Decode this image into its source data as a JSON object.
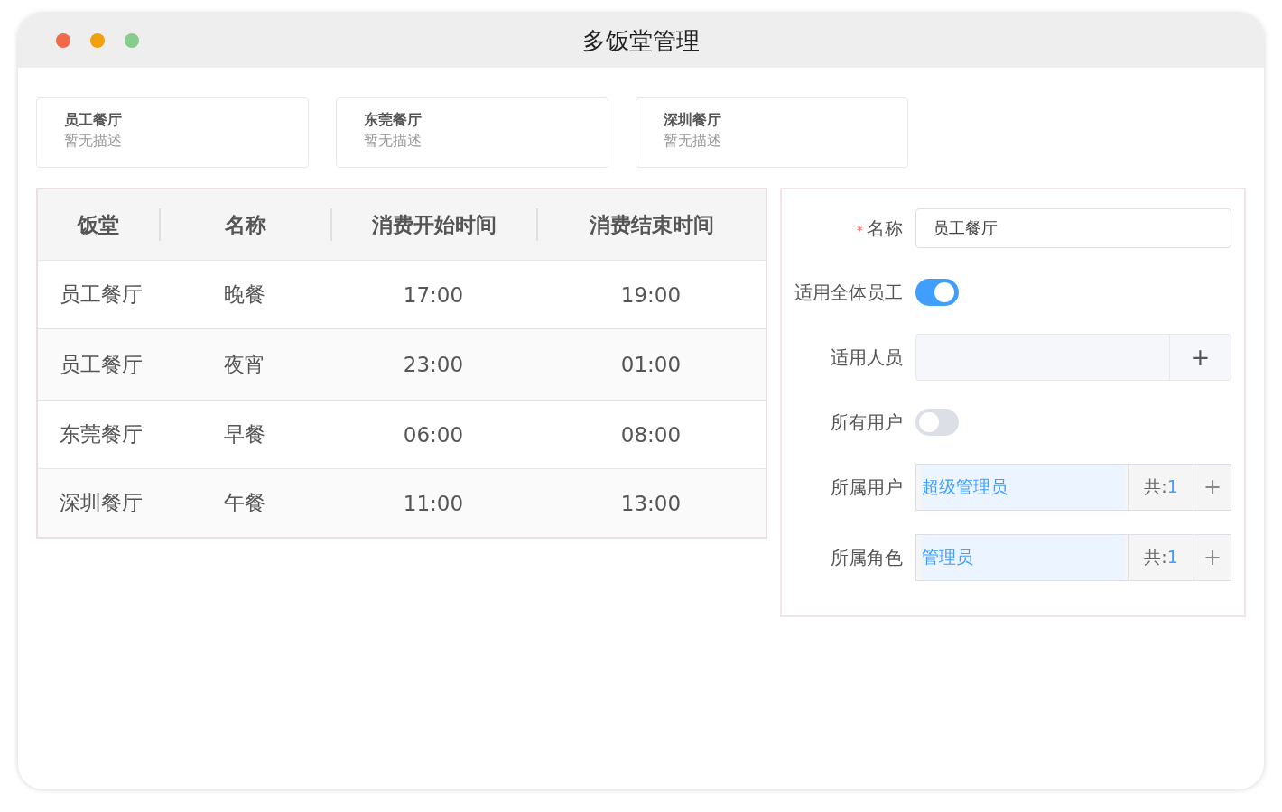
{
  "window": {
    "title": "多饭堂管理"
  },
  "cards": [
    {
      "title": "员工餐厅",
      "description": "暂无描述"
    },
    {
      "title": "东莞餐厅",
      "description": "暂无描述"
    },
    {
      "title": "深圳餐厅",
      "description": "暂无描述"
    }
  ],
  "table": {
    "columns": [
      "饭堂",
      "名称",
      "消费开始时间",
      "消费结束时间"
    ],
    "rows": [
      [
        "员工餐厅",
        "晚餐",
        "17:00",
        "19:00"
      ],
      [
        "员工餐厅",
        "夜宵",
        "23:00",
        "01:00"
      ],
      [
        "东莞餐厅",
        "早餐",
        "06:00",
        "08:00"
      ],
      [
        "深圳餐厅",
        "午餐",
        "11:00",
        "13:00"
      ]
    ]
  },
  "form": [
    {
      "kind": "text",
      "label": "名称",
      "required_mark": "*",
      "value": "员工餐厅"
    },
    {
      "kind": "switch",
      "label": "适用全体员工",
      "on": true
    },
    {
      "kind": "add",
      "label": "适用人员",
      "button": "+"
    },
    {
      "kind": "switch",
      "label": "所有用户",
      "on": false
    },
    {
      "kind": "picker",
      "label": "所属用户",
      "value": "超级管理员",
      "count_label": "共:",
      "count": "1",
      "button": "+"
    },
    {
      "kind": "picker",
      "label": "所属角色",
      "value": "管理员",
      "count_label": "共:",
      "count": "1",
      "button": "+"
    }
  ]
}
